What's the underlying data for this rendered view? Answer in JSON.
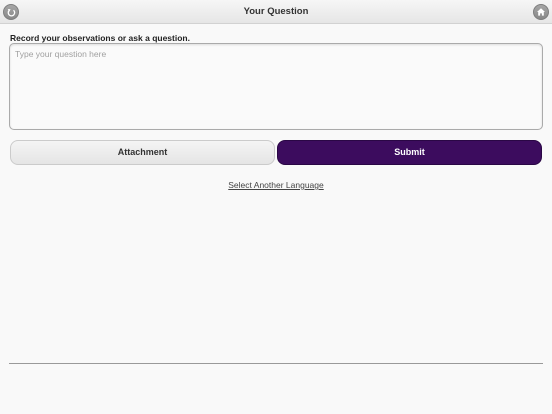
{
  "header": {
    "title": "Your Question",
    "back_icon": "back-arrow-icon",
    "home_icon": "home-icon"
  },
  "form": {
    "prompt": "Record your observations or ask a question.",
    "question_value": "",
    "question_placeholder": "Type your question here"
  },
  "buttons": {
    "attachment_label": "Attachment",
    "submit_label": "Submit"
  },
  "links": {
    "language_label": "Select Another Language"
  },
  "colors": {
    "submit_bg": "#3c0c5e",
    "page_bg": "#f9f9f9"
  }
}
